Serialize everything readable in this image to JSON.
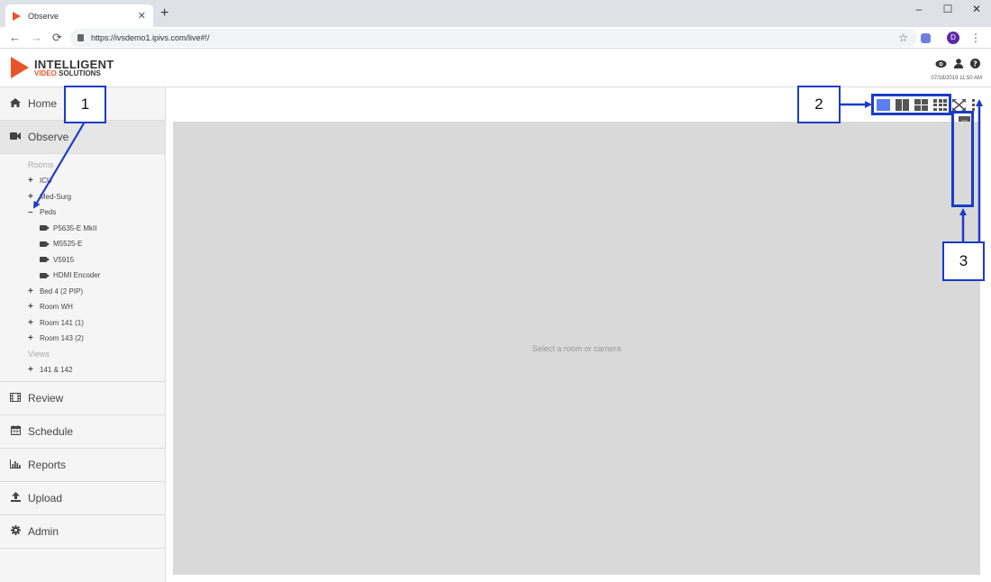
{
  "browser": {
    "tab_title": "Observe",
    "tab_close": "✕",
    "new_tab": "+",
    "url": "https://ivsdemo1.ipivs.com/live#!/",
    "profile_initial": "D",
    "win_min": "–",
    "win_max": "☐",
    "win_close": "✕"
  },
  "header": {
    "logo_line1": "INTELLIGENT",
    "logo_line2a": "VIDEO",
    "logo_line2b": " SOLUTIONS",
    "timestamp": "07/18/2019 11:50 AM"
  },
  "sidebar": {
    "home": "Home",
    "observe": "Observe",
    "rooms_heading": "Rooms",
    "rooms": [
      {
        "sign": "+",
        "label": "ICU"
      },
      {
        "sign": "+",
        "label": "Med-Surg"
      },
      {
        "sign": "–",
        "label": "Peds"
      }
    ],
    "cameras": [
      "P5635-E MkII",
      "M5525-E",
      "V5915",
      "HDMI Encoder"
    ],
    "rooms_after": [
      {
        "sign": "+",
        "label": "Bed 4 (2 PIP)"
      },
      {
        "sign": "+",
        "label": "Room WH"
      },
      {
        "sign": "+",
        "label": "Room 141 (1)"
      },
      {
        "sign": "+",
        "label": "Room 143 (2)"
      }
    ],
    "views_heading": "Views",
    "views": [
      {
        "sign": "+",
        "label": "141 & 142"
      }
    ],
    "review": "Review",
    "schedule": "Schedule",
    "reports": "Reports",
    "upload": "Upload",
    "admin": "Admin"
  },
  "main": {
    "placeholder": "Select a room or camera"
  },
  "annotations": {
    "a1": "1",
    "a2": "2",
    "a3": "3"
  },
  "colors": {
    "accent": "#5b7df0",
    "annotation": "#1a3cc8",
    "brand": "#e8542a"
  }
}
